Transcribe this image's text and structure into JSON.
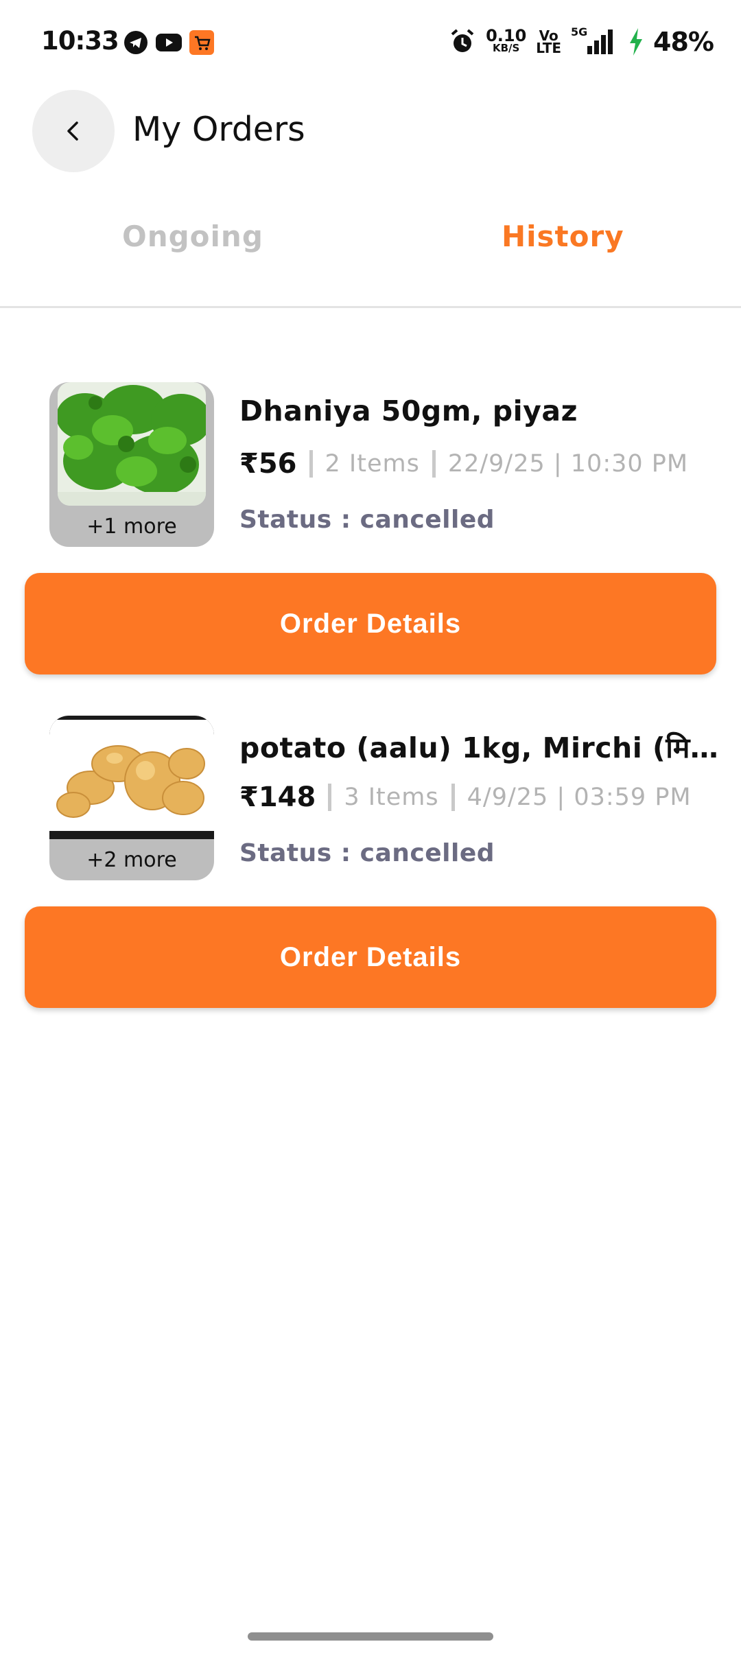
{
  "status_bar": {
    "time": "10:33",
    "net_speed_value": "0.10",
    "net_speed_unit": "KB/S",
    "volte_top": "Vo",
    "volte_bottom": "LTE",
    "signal_label": "5G",
    "battery": "48%",
    "icons": [
      "telegram-icon",
      "youtube-icon",
      "cart-app-icon",
      "alarm-icon",
      "signal-icon",
      "charging-icon"
    ]
  },
  "header": {
    "title": "My Orders",
    "back_icon": "chevron-left-icon"
  },
  "tabs": [
    {
      "label": "Ongoing",
      "active": false
    },
    {
      "label": "History",
      "active": true
    }
  ],
  "orders": [
    {
      "title": "Dhaniya 50gm, piyaz",
      "price": "₹56",
      "items": "2 Items",
      "date": "22/9/25 | 10:30 PM",
      "status": "Status : cancelled",
      "more": "+1 more",
      "image": "coriander-image",
      "button_label": "Order Details"
    },
    {
      "title": "potato (aalu) 1kg, Mirchi (मिर्ची...",
      "price": "₹148",
      "items": "3 Items",
      "date": "4/9/25 | 03:59 PM",
      "status": "Status : cancelled",
      "more": "+2 more",
      "image": "potato-image",
      "button_label": "Order Details"
    }
  ],
  "colors": {
    "accent": "#fd7724",
    "tab_active": "#fa7823",
    "tab_inactive": "#c2c2c2",
    "status_text": "#6b6b82"
  }
}
